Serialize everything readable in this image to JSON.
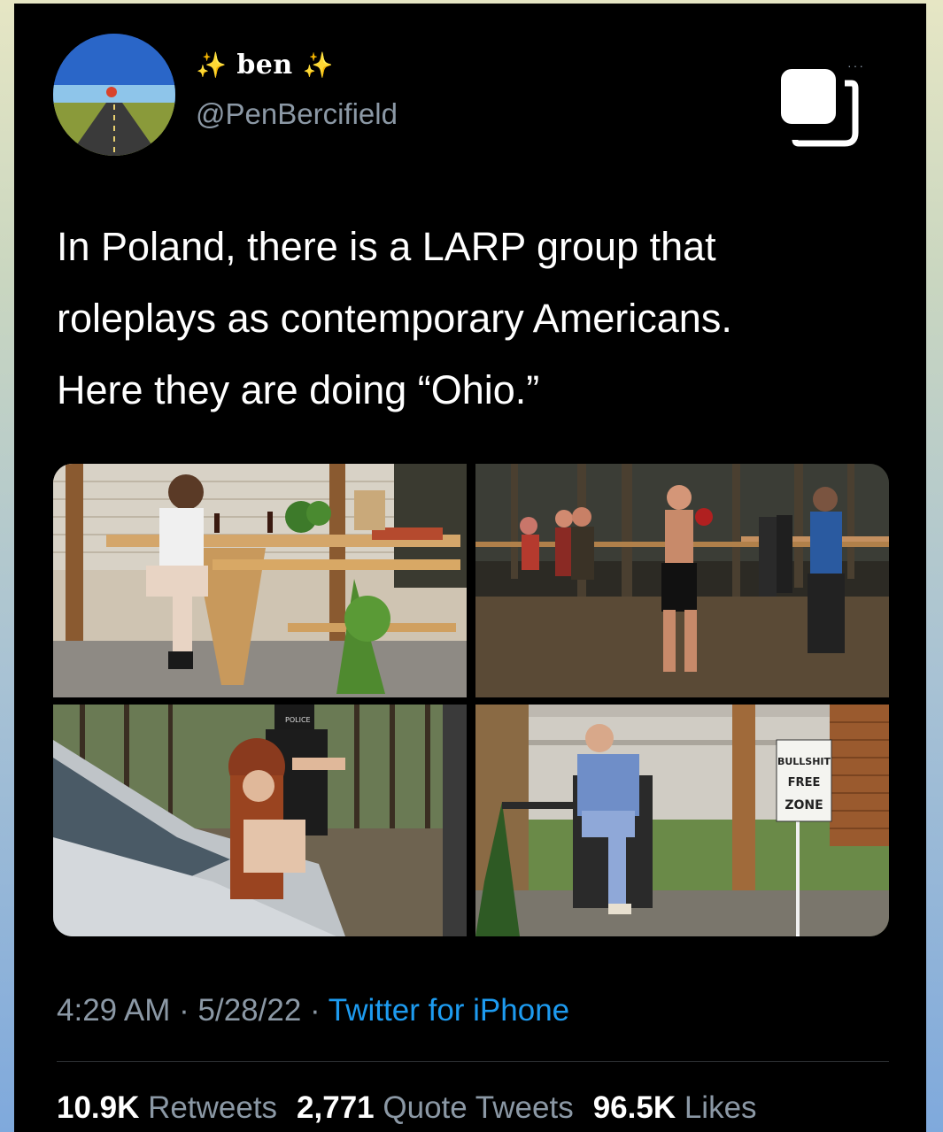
{
  "user": {
    "display_name": "ben",
    "sparkle_left": "✨",
    "sparkle_right": "✨",
    "handle": "@PenBercifield"
  },
  "header": {
    "more_icon": "···",
    "copy_icon": "copy-icon"
  },
  "tweet": {
    "lines": [
      "In Poland, there is a LARP group that",
      "roleplays as contemporary Americans.",
      "Here they are doing “Ohio.”"
    ]
  },
  "media": {
    "sign_text": [
      "BULLSHIT",
      "FREE",
      "ZONE"
    ],
    "cap_text": "POLICE"
  },
  "meta": {
    "time": "4:29 AM",
    "separator": " · ",
    "date": "5/28/22",
    "source": "Twitter for iPhone"
  },
  "stats": {
    "retweets_count": "10.9K",
    "retweets_label": "Retweets",
    "quotes_count": "2,771",
    "quotes_label": "Quote Tweets",
    "likes_count": "96.5K",
    "likes_label": "Likes"
  },
  "colors": {
    "background": "#000000",
    "text": "#ffffff",
    "muted": "#8b98a5",
    "link": "#1d9bf0",
    "sparkle": "#f5d442"
  }
}
